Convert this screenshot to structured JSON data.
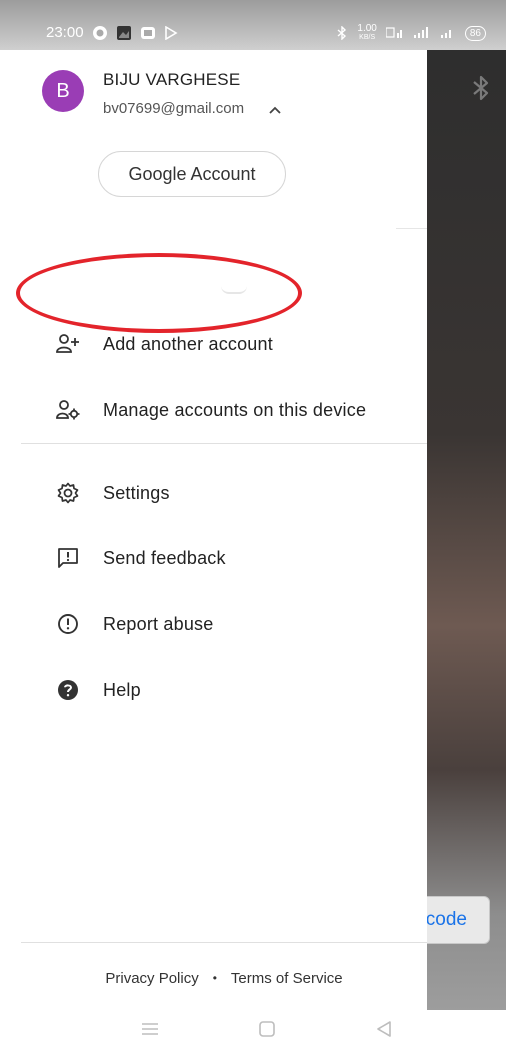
{
  "status_bar": {
    "time": "23:00",
    "speed_top": "1.00",
    "speed_bottom": "KB/S",
    "battery": "86"
  },
  "account": {
    "avatar_letter": "B",
    "avatar_color": "#9a3db5",
    "name": "BIJU VARGHESE",
    "email": "bv07699@gmail.com"
  },
  "google_account_button": "Google Account",
  "menu": {
    "add_account": "Add another account",
    "manage_accounts": "Manage accounts on this device",
    "settings": "Settings",
    "send_feedback": "Send feedback",
    "report_abuse": "Report abuse",
    "help": "Help"
  },
  "footer": {
    "privacy": "Privacy Policy",
    "separator": "•",
    "terms": "Terms of Service"
  },
  "background": {
    "code_button": "code"
  },
  "colors": {
    "highlight": "#e3242b",
    "link": "#1a73e8"
  }
}
